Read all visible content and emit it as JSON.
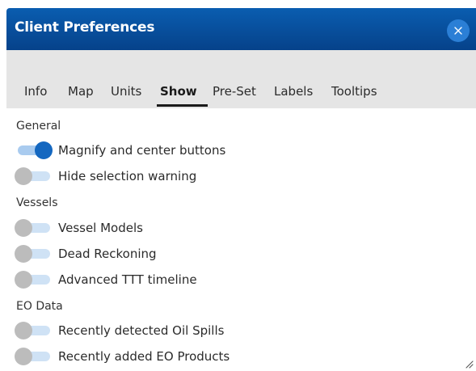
{
  "dialog": {
    "title": "Client Preferences",
    "close_label": "×"
  },
  "tabs": [
    {
      "label": "Info",
      "active": false
    },
    {
      "label": "Map",
      "active": false
    },
    {
      "label": "Units",
      "active": false
    },
    {
      "label": "Show",
      "active": true
    },
    {
      "label": "Pre-Set",
      "active": false
    },
    {
      "label": "Labels",
      "active": false
    },
    {
      "label": "Tooltips",
      "active": false
    }
  ],
  "sections": {
    "general": {
      "heading": "General",
      "items": [
        {
          "label": "Magnify and center buttons",
          "on": true
        },
        {
          "label": "Hide selection warning",
          "on": false
        }
      ]
    },
    "vessels": {
      "heading": "Vessels",
      "items": [
        {
          "label": "Vessel Models",
          "on": false
        },
        {
          "label": "Dead Reckoning",
          "on": false
        },
        {
          "label": "Advanced TTT timeline",
          "on": false
        }
      ]
    },
    "eo_data": {
      "heading": "EO Data",
      "items": [
        {
          "label": "Recently detected Oil Spills",
          "on": false
        },
        {
          "label": "Recently added EO Products",
          "on": false
        }
      ]
    }
  },
  "colors": {
    "header_top": "#0a5db0",
    "header_bottom": "#06428a",
    "tab_bar": "#e5e5e5",
    "switch_on": "#1467c0",
    "switch_off": "#bcbcbc",
    "track": "#cfe2f5"
  },
  "icons": {
    "close": "close-icon",
    "resize": "resize-handle-icon"
  }
}
